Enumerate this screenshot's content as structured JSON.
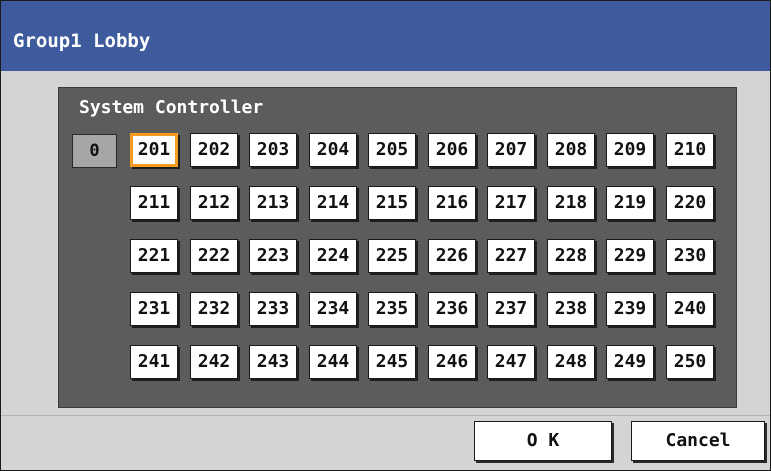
{
  "window": {
    "title": "Group1 Lobby"
  },
  "panel": {
    "label": "System Controller",
    "address_value": "0"
  },
  "grid": {
    "selected": "201",
    "rows": [
      [
        "201",
        "202",
        "203",
        "204",
        "205",
        "206",
        "207",
        "208",
        "209",
        "210"
      ],
      [
        "211",
        "212",
        "213",
        "214",
        "215",
        "216",
        "217",
        "218",
        "219",
        "220"
      ],
      [
        "221",
        "222",
        "223",
        "224",
        "225",
        "226",
        "227",
        "228",
        "229",
        "230"
      ],
      [
        "231",
        "232",
        "233",
        "234",
        "235",
        "236",
        "237",
        "238",
        "239",
        "240"
      ],
      [
        "241",
        "242",
        "243",
        "244",
        "245",
        "246",
        "247",
        "248",
        "249",
        "250"
      ]
    ]
  },
  "buttons": {
    "ok_label": "O K",
    "cancel_label": "Cancel"
  },
  "colors": {
    "titlebar": "#3e5b9e",
    "panel": "#5c5c5c",
    "selected_border": "#f39c1f"
  }
}
